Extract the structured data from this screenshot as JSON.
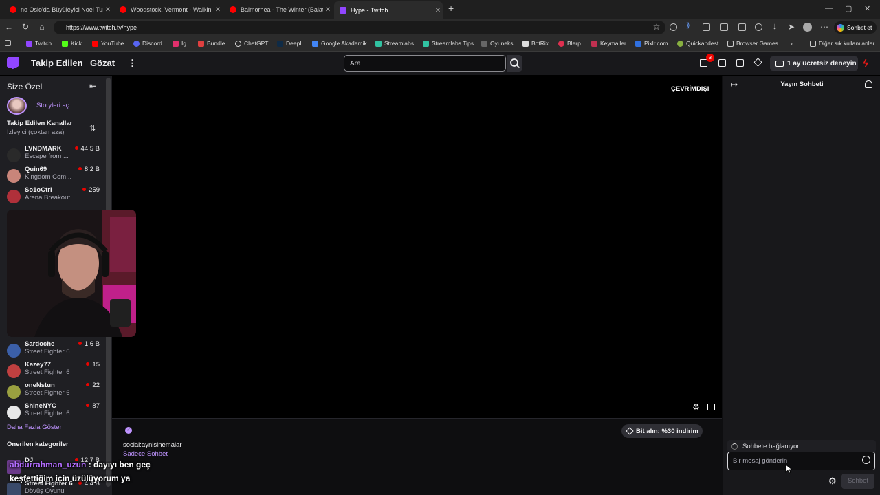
{
  "browser": {
    "tabs": [
      {
        "title": "no Oslo'da Büyüleyici Noel Turu",
        "color": "#ff0000"
      },
      {
        "title": "Woodstock, Vermont - Walkin",
        "color": "#ff0000"
      },
      {
        "title": "Balmorhea - The Winter (Balat",
        "color": "#ff0000"
      },
      {
        "title": "Hype - Twitch",
        "color": "#9146ff"
      }
    ],
    "url": "https://www.twitch.tv/hype",
    "copilot_label": "Sohbet et",
    "bookmarks": [
      "Twitch",
      "Kick",
      "YouTube",
      "Discord",
      "Ig",
      "Bundle",
      "ChatGPT",
      "DeepL",
      "Google Akademik",
      "Streamlabs",
      "Streamlabs Tips",
      "Oyuneks",
      "BotRix",
      "Blerp",
      "Keymailer",
      "Pixlr.com",
      "Quickabdest",
      "Browser Games"
    ],
    "other_bookmarks": "Diğer sık kullanılanlar"
  },
  "twitch": {
    "nav_following": "Takip Edilen",
    "nav_browse": "Gözat",
    "search_placeholder": "Ara",
    "notif_count": "3",
    "prime_label": "1 ay ücretsiz deneyin"
  },
  "sidebar": {
    "title": "Size Özel",
    "stories_label": "Storyleri aç",
    "followed_title": "Takip Edilen Kanallar",
    "followed_sub": "İzleyici (çoktan aza)",
    "channels_top": [
      {
        "name": "LVNDMARK",
        "game": "Escape from ...",
        "viewers": "44,5 B",
        "color": "#2a2a2a"
      },
      {
        "name": "Quin69",
        "game": "Kingdom Com...",
        "viewers": "8,2 B",
        "color": "#c9857a"
      },
      {
        "name": "So1oCtrl",
        "game": "Arena Breakout...",
        "viewers": "259",
        "color": "#b0303a"
      }
    ],
    "channels_bottom": [
      {
        "name": "Sardoche",
        "game": "Street Fighter 6",
        "viewers": "1,6 B",
        "color": "#3b5fa8"
      },
      {
        "name": "Kazey77",
        "game": "Street Fighter 6",
        "viewers": "15",
        "color": "#c04040"
      },
      {
        "name": "oneNstun",
        "game": "Street Fighter 6",
        "viewers": "22",
        "color": "#9aa040"
      },
      {
        "name": "ShineNYC",
        "game": "Street Fighter 6",
        "viewers": "87",
        "color": "#e8e8e8"
      }
    ],
    "show_more": "Daha Fazla Göster",
    "recommended_title": "Önerilen kategoriler",
    "categories": [
      {
        "name": "DJ",
        "viewers": "12,7 B"
      },
      {
        "name": "Street Fighter 6",
        "sub": "Dövüş Oyunu",
        "viewers": "4,4 B"
      }
    ]
  },
  "player": {
    "offline_label": "ÇEVRİMDIŞI",
    "social_text": "social:aynisinemalar",
    "chat_mode": "Sadece Sohbet",
    "bits_label": "Bit alın: %30 indirim"
  },
  "overlay": {
    "username": "abdurrahman_uzun",
    "message_first": " : dayıyı ben geç",
    "message_second": "keşfettiğim için üzülüyorum ya"
  },
  "chat": {
    "title": "Yayın Sohbeti",
    "connecting": "Sohbete bağlanıyor",
    "input_placeholder": "Bir mesaj gönderin",
    "send_label": "Sohbet"
  }
}
